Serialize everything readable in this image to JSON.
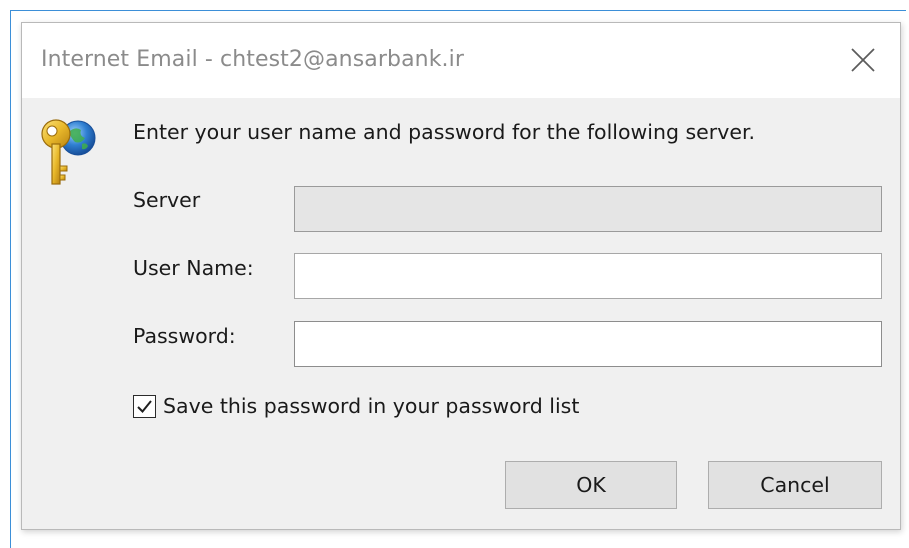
{
  "window": {
    "title": "Internet Email - chtest2@ansarbank.ir"
  },
  "prompt": {
    "text": "Enter your user name and password for the following server."
  },
  "form": {
    "server": {
      "label": "Server",
      "value": "",
      "enabled": false
    },
    "username": {
      "label": "User Name:",
      "value": ""
    },
    "password": {
      "label": "Password:",
      "value": ""
    },
    "save_password": {
      "label": "Save this password in your password list",
      "checked": true
    }
  },
  "buttons": {
    "ok_label": "OK",
    "cancel_label": "Cancel"
  },
  "icons": {
    "close": "close-icon",
    "key": "key-globe-icon",
    "check": "checkmark-icon"
  },
  "colors": {
    "window_border": "#3c8fd8",
    "dialog_bg": "#f0f0f0",
    "button_bg": "#e1e1e1",
    "key_gold": "#e8b82a",
    "globe_blue": "#2f7fd1"
  }
}
